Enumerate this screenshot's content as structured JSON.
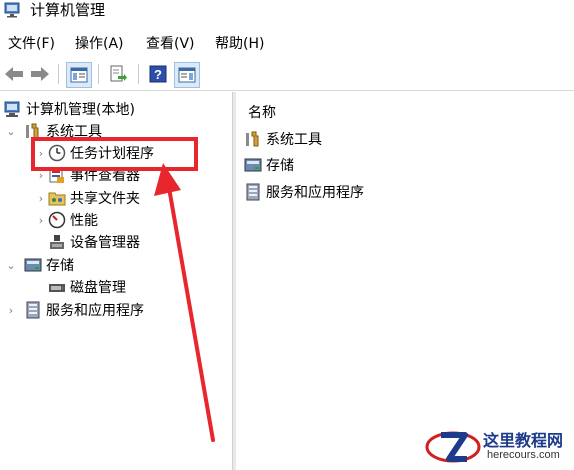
{
  "window": {
    "title": "计算机管理"
  },
  "menubar": {
    "items": [
      "文件(F)",
      "操作(A)",
      "查看(V)",
      "帮助(H)"
    ]
  },
  "toolbar": {
    "icons": [
      "back-icon",
      "forward-icon",
      "show-hide-console-tree-icon",
      "export-list-icon",
      "help-icon",
      "show-hide-action-pane-icon"
    ]
  },
  "tree": {
    "root": "计算机管理(本地)",
    "system_tools": "系统工具",
    "task_scheduler": "任务计划程序",
    "event_viewer": "事件查看器",
    "shared_folders": "共享文件夹",
    "performance": "性能",
    "device_manager": "设备管理器",
    "storage": "存储",
    "disk_management": "磁盘管理",
    "services_apps": "服务和应用程序"
  },
  "list": {
    "column_header": "名称",
    "items": [
      "系统工具",
      "存储",
      "服务和应用程序"
    ]
  },
  "annotation": {
    "color": "#e8262d"
  },
  "watermark": {
    "title": "这里教程网",
    "site": "herecours.com"
  }
}
